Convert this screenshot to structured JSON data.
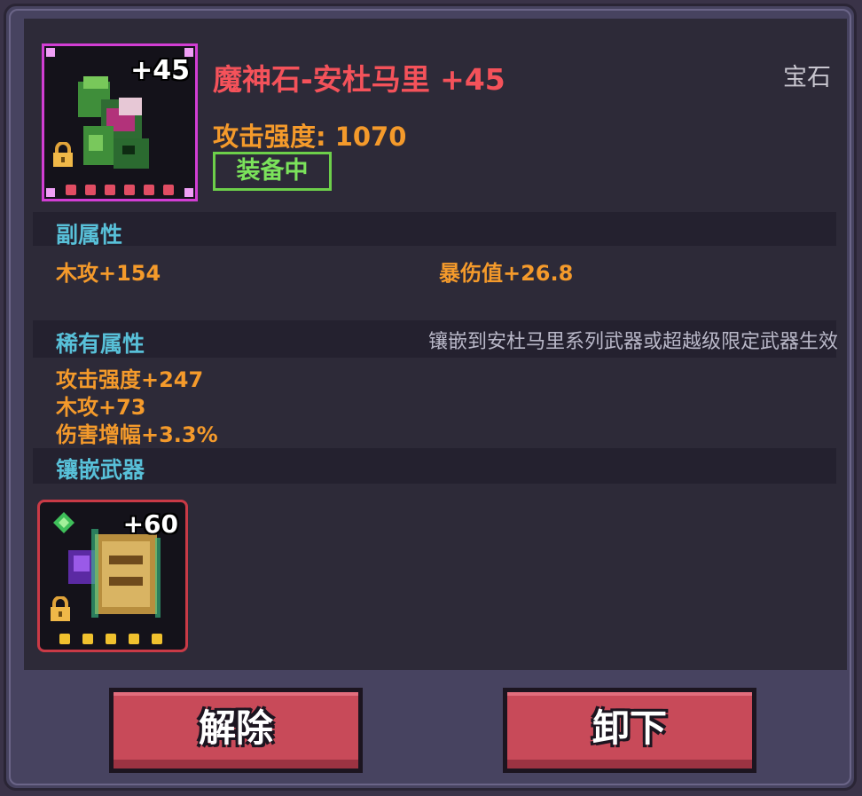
{
  "item": {
    "name": "魔神石-安杜马里 +45",
    "category": "宝石",
    "level_badge": "+45",
    "attack": "攻击强度: 1070",
    "status": "装备中",
    "rarity_color": "#d23ed4"
  },
  "secondary": {
    "title": "副属性",
    "stats": [
      "木攻+154",
      "暴伤值+26.8"
    ]
  },
  "rare": {
    "title": "稀有属性",
    "note": "镶嵌到安杜马里系列武器或超越级限定武器生效",
    "stats": [
      "攻击强度+247",
      "木攻+73",
      "伤害增幅+3.3%"
    ]
  },
  "weapon": {
    "title": "镶嵌武器",
    "level_badge": "+60",
    "rarity_color": "#c93a46"
  },
  "buttons": {
    "remove": "解除",
    "unequip": "卸下"
  }
}
